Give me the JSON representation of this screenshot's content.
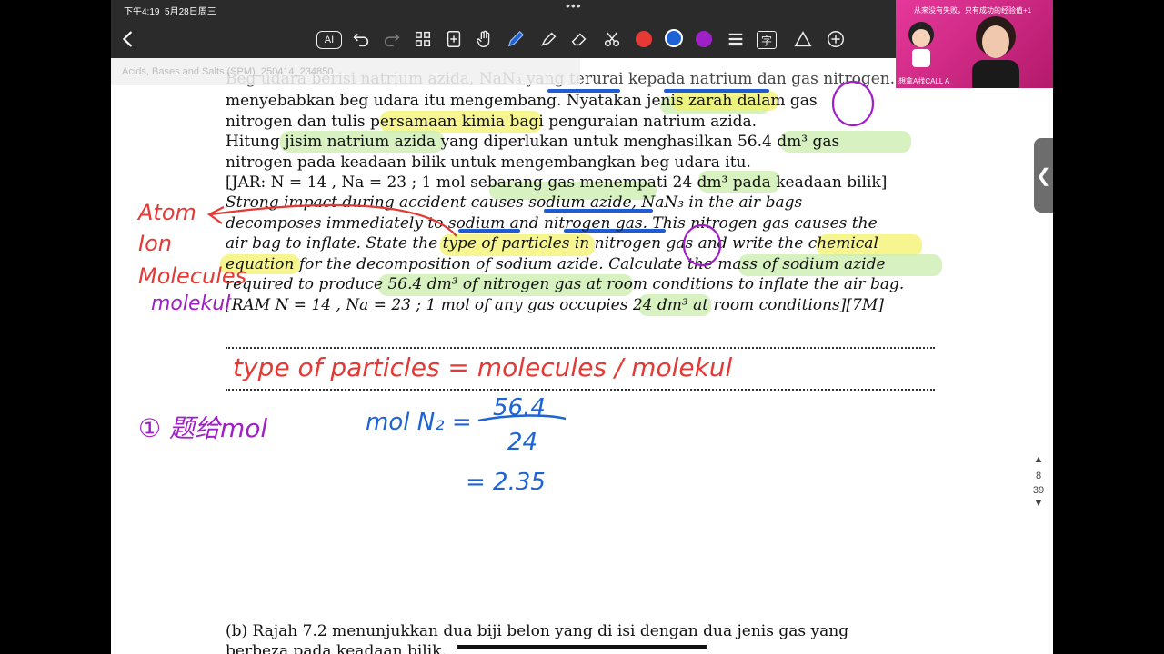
{
  "status": {
    "time": "下午4:19",
    "date": "5月28日周三",
    "dots": "•••"
  },
  "toolbar": {
    "icons": [
      "back-chevron-icon",
      "ai-icon",
      "undo-icon",
      "redo-icon",
      "grid-icon",
      "add-page-icon",
      "hand-icon",
      "pen-icon",
      "highlighter-icon",
      "eraser-icon",
      "scissors-icon",
      "color-red",
      "color-blue",
      "color-purple",
      "line-weight-icon",
      "text-icon",
      "shape-icon",
      "add-icon"
    ],
    "ai_label": "AI",
    "text_label": "字",
    "colors": {
      "red": "#e53935",
      "blue": "#1e63d6",
      "purple": "#a020c8"
    }
  },
  "file": {
    "name": "Acids, Bases and Salts (SPM)_250414_234850"
  },
  "question": {
    "malay": [
      "Beg udara berisi natrium azida, NaN₃ yang terurai kepada natrium dan gas nitrogen. Gas nitrogen",
      "menyebabkan beg udara itu mengembang. Nyatakan jenis zarah dalam gas",
      "nitrogen dan tulis persamaan kimia bagi penguraian natrium azida.",
      "Hitung jisim natrium azida yang diperlukan untuk menghasilkan 56.4 dm³ gas",
      "nitrogen pada keadaan bilik untuk mengembangkan beg udara itu.",
      "[JAR: N = 14 , Na = 23 ; 1 mol sebarang gas menempati 24 dm³ pada keadaan bilik]"
    ],
    "english": [
      "Strong impact during accident causes sodium azide, NaN₃ in the air bags",
      "decomposes immediately to sodium and nitrogen gas. This nitrogen gas causes the",
      "air bag to inflate. State the type of particles in nitrogen gas and write the chemical",
      "equation for the decomposition of sodium azide. Calculate the mass of sodium azide",
      "required to produce 56.4 dm³ of nitrogen gas at room conditions to inflate the air bag.",
      "[RAM N = 14 , Na = 23 ; 1 mol of any gas occupies 24 dm³ at room conditions][7M]"
    ],
    "part_b": [
      "(b) Rajah 7.2 menunjukkan dua biji belon yang di isi dengan dua jenis gas yang",
      "berbeza pada keadaan bilik."
    ]
  },
  "notes": {
    "particle_types": [
      "Atom",
      "Ion",
      "Molecules",
      "molekul"
    ],
    "answer_line": "type of particles = molecules / molekul",
    "step_label": "① 题给mol",
    "calc": {
      "lhs": "mol N₂ =",
      "numerator": "56.4",
      "denominator": "24",
      "result": "= 2.35"
    }
  },
  "pager": {
    "current": "8",
    "total": "39"
  },
  "webcam": {
    "ad_text": "从来没有失败，只有成功的经验值+1",
    "cta": "想拿A找CALL A"
  }
}
